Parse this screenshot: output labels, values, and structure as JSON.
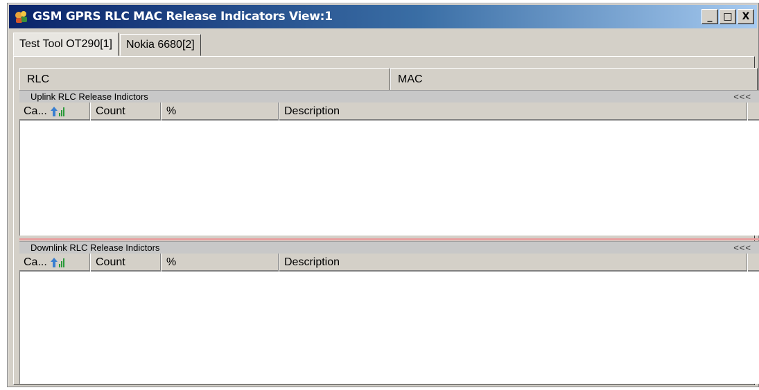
{
  "window": {
    "title": "GSM GPRS RLC MAC Release Indicators View:1",
    "buttons": {
      "minimize": "_",
      "maximize": "□",
      "close": "X"
    }
  },
  "tabs": [
    {
      "label": "Test Tool OT290[1]",
      "active": true
    },
    {
      "label": "Nokia 6680[2]",
      "active": false
    }
  ],
  "subtabs": [
    {
      "label": "RLC"
    },
    {
      "label": "MAC"
    }
  ],
  "uplink": {
    "title": "Uplink RLC Release Indictors",
    "collapse": "<<<",
    "columns": [
      "Ca...",
      "Count",
      "%",
      "Description"
    ],
    "rows": []
  },
  "downlink": {
    "title": "Downlink RLC Release Indictors",
    "collapse": "<<<",
    "columns": [
      "Ca...",
      "Count",
      "%",
      "Description"
    ],
    "rows": []
  },
  "colors": {
    "titlebar_start": "#0a246a",
    "titlebar_end": "#a6caf0",
    "face": "#d4d0c8",
    "splitter": "#e8a0a0"
  }
}
